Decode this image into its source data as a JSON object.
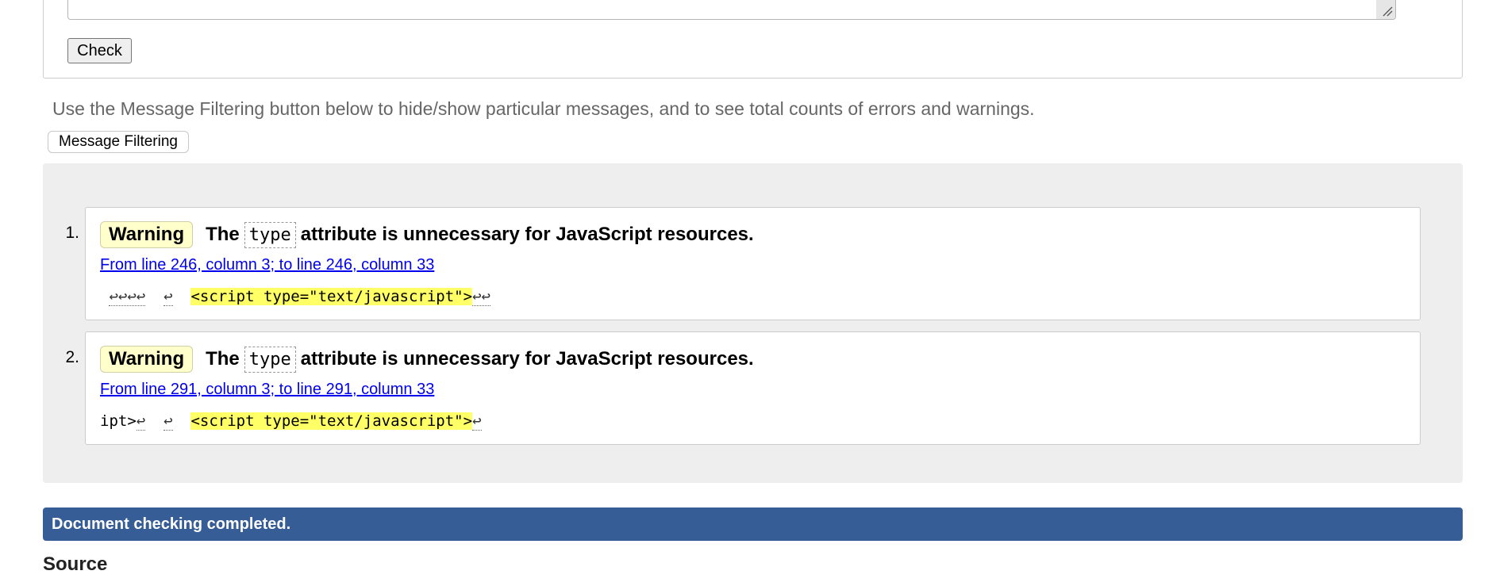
{
  "form": {
    "check_label": "Check"
  },
  "hint_text": "Use the Message Filtering button below to hide/show particular messages, and to see total counts of errors and warnings.",
  "filter_button_label": "Message Filtering",
  "messages": [
    {
      "number": "1.",
      "severity": "Warning",
      "text_before": "The",
      "code": "type",
      "text_after": "attribute is unnecessary for JavaScript resources.",
      "location": "From line 246, column 3; to line 246, column 33",
      "extract_prefix": "",
      "extract_lf_lead": "↩↩↩↩",
      "extract_gap": "↩",
      "extract_highlight": "<script type=\"text/javascript\">",
      "extract_lf_tail": "↩↩"
    },
    {
      "number": "2.",
      "severity": "Warning",
      "text_before": "The",
      "code": "type",
      "text_after": "attribute is unnecessary for JavaScript resources.",
      "location": "From line 291, column 3; to line 291, column 33",
      "extract_prefix": "ipt>",
      "extract_lf_lead": "↩",
      "extract_gap": "↩",
      "extract_highlight": "<script type=\"text/javascript\">",
      "extract_lf_tail": "↩"
    }
  ],
  "status": {
    "completed_text": "Document checking completed."
  },
  "source_heading": "Source",
  "colors": {
    "status_bar": "#365d95",
    "highlight": "#ffff66",
    "badge": "#ffffcc",
    "link": "#0000ee"
  }
}
